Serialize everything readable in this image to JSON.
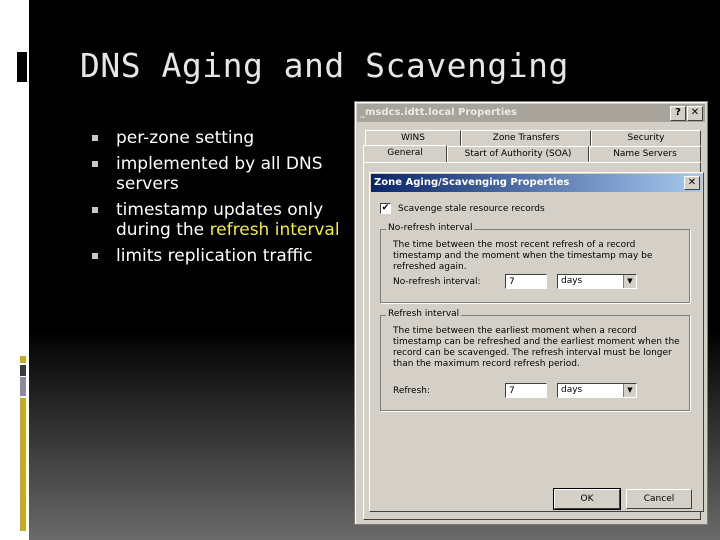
{
  "slide": {
    "title": "DNS Aging and Scavenging",
    "bullets": [
      {
        "text": "per-zone setting"
      },
      {
        "text": "implemented by all DNS servers"
      },
      {
        "text_before": "timestamp updates only during the ",
        "highlight": "refresh interval"
      },
      {
        "text": "limits replication traffic"
      }
    ],
    "colors": {
      "highlight": "#f2ec3a",
      "accent_bar": "#c9aa23",
      "background": "#000000"
    }
  },
  "properties_window": {
    "title": "_msdcs.idtt.local Properties",
    "help_button": "?",
    "close_button": "✕",
    "tabs_row1": [
      "WINS",
      "Zone Transfers",
      "Security"
    ],
    "tabs_row2": [
      "General",
      "Start of Authority (SOA)",
      "Name Servers"
    ],
    "active_tab": "General"
  },
  "aging_dialog": {
    "title": "Zone Aging/Scavenging Properties",
    "close_button": "✕",
    "scavenge_checkbox": {
      "label": "Scavenge stale resource records",
      "checked": true,
      "mark": "✔"
    },
    "no_refresh": {
      "group_label": "No-refresh interval",
      "description": "The time between the most recent refresh of a record timestamp and the moment when the timestamp may be refreshed again.",
      "field_label": "No-refresh interval:",
      "value": "7",
      "unit": "days"
    },
    "refresh": {
      "group_label": "Refresh interval",
      "description": "The time between the earliest moment when a record timestamp can be refreshed and the earliest moment when the record can be scavenged. The refresh interval must be longer than the maximum record refresh period.",
      "field_label": "Refresh:",
      "value": "7",
      "unit": "days"
    },
    "dropdown_arrow": "▼",
    "ok_label": "OK",
    "cancel_label": "Cancel"
  }
}
